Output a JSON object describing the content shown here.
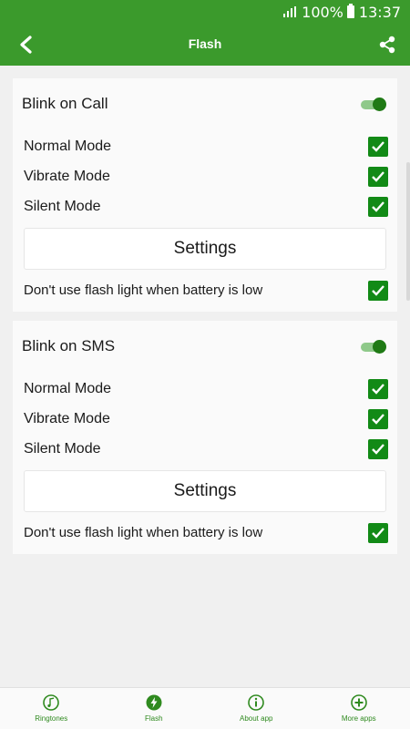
{
  "status_bar": {
    "battery": "100%",
    "time": "13:37"
  },
  "app_bar": {
    "title": "Flash",
    "back_icon": "chevron-left-icon",
    "share_icon": "share-icon"
  },
  "cards": [
    {
      "title": "Blink on Call",
      "enabled": true,
      "modes": [
        {
          "label": "Normal Mode",
          "checked": true
        },
        {
          "label": "Vibrate Mode",
          "checked": true
        },
        {
          "label": "Silent Mode",
          "checked": true
        }
      ],
      "settings_label": "Settings",
      "battery_option": {
        "label": "Don't use flash light when battery is low",
        "checked": true
      }
    },
    {
      "title": "Blink on SMS",
      "enabled": true,
      "modes": [
        {
          "label": "Normal Mode",
          "checked": true
        },
        {
          "label": "Vibrate Mode",
          "checked": true
        },
        {
          "label": "Silent Mode",
          "checked": true
        }
      ],
      "settings_label": "Settings",
      "battery_option": {
        "label": "Don't use flash light when battery is low",
        "checked": true
      }
    }
  ],
  "bottom_nav": [
    {
      "label": "Ringtones",
      "icon": "music-note-icon"
    },
    {
      "label": "Flash",
      "icon": "flash-icon"
    },
    {
      "label": "About app",
      "icon": "info-icon"
    },
    {
      "label": "More apps",
      "icon": "plus-circle-icon"
    }
  ],
  "colors": {
    "primary": "#3b9a2c",
    "checkbox": "#128a16",
    "toggle_thumb": "#1f7a15",
    "toggle_track": "#8fc98a"
  }
}
